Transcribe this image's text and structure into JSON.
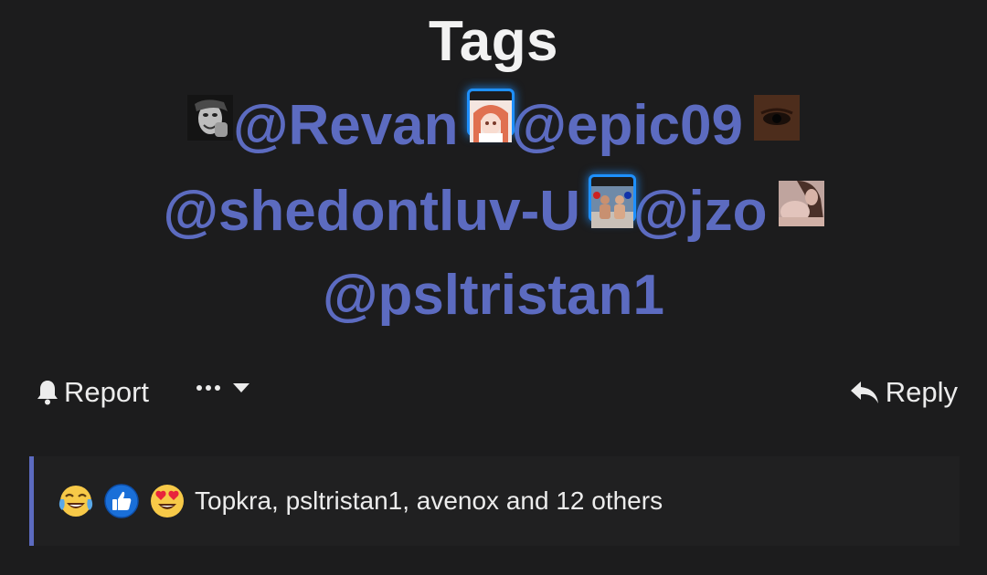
{
  "post": {
    "title": "Tags",
    "mentions": [
      {
        "name": "@Revan",
        "avatar_icon": "avatar-photo-bw-icon",
        "avatar_color": "#3a3a3a",
        "framed": false
      },
      {
        "name": "@epic09",
        "avatar_icon": "avatar-anime-girl-icon",
        "avatar_color": "#d9a0a0",
        "framed": true
      },
      {
        "name": "@shedontluv-U",
        "avatar_icon": "avatar-eye-closeup-icon",
        "avatar_color": "#4a2a1a",
        "framed": false
      },
      {
        "name": "@jzo",
        "avatar_icon": "avatar-boxers-icon",
        "avatar_color": "#8aa0b8",
        "framed": true
      },
      {
        "name": "@psltristan1",
        "avatar_icon": "avatar-woman-photo-icon",
        "avatar_color": "#c7a6a0",
        "framed": false
      }
    ],
    "mention_color": "#5c6bc0",
    "frame_color": "#1e90ff"
  },
  "actions": {
    "report_label": "Report",
    "report_icon": "bell-icon",
    "more_icon": "ellipsis-icon",
    "dropdown_icon": "caret-down-icon",
    "reply_label": "Reply",
    "reply_icon": "reply-arrow-icon"
  },
  "reactions": {
    "emojis": [
      "crying-laughing-emoji",
      "thumbs-up-emoji",
      "heart-eyes-emoji"
    ],
    "summary": "Topkra, psltristan1, avenox and 12 others",
    "accent": "#5c6bc0"
  }
}
